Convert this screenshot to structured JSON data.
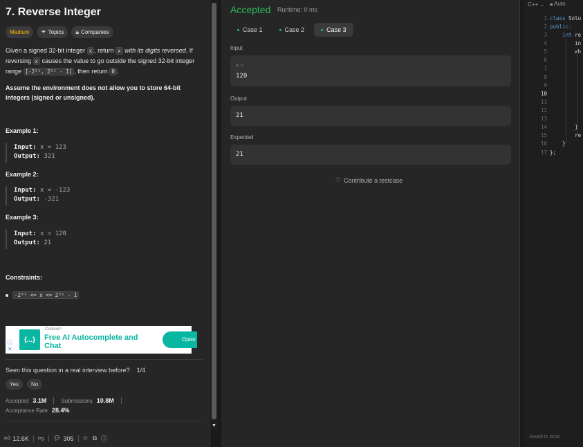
{
  "problem": {
    "title": "7. Reverse Integer",
    "tags": {
      "difficulty": "Medium",
      "topics": "Topics",
      "companies": "Companies"
    },
    "desc": {
      "p1": "Given a signed 32-bit integer",
      "x": "x",
      "p2": ", return",
      "p3": "with its digits reversed",
      "p4": ". If reversing",
      "p5": "causes the value to go outside the signed 32-bit integer range",
      "range_chip": "[-2³¹, 2³¹ - 1]",
      "p6": ", then return",
      "zero": "0",
      "p7": "."
    },
    "note": "Assume the environment does not allow you to store 64-bit integers (signed or unsigned).",
    "examples": [
      {
        "title": "Example 1:",
        "input_label": "Input:",
        "input": "x = 123",
        "output_label": "Output:",
        "output": "321"
      },
      {
        "title": "Example 2:",
        "input_label": "Input:",
        "input": "x = -123",
        "output_label": "Output:",
        "output": "-321"
      },
      {
        "title": "Example 3:",
        "input_label": "Input:",
        "input": "x = 120",
        "output_label": "Output:",
        "output": "21"
      }
    ],
    "constraints_title": "Constraints:",
    "constraint": "-2³¹ <= x <= 2³¹ - 1"
  },
  "ad": {
    "brand": "Codeium",
    "logo": "{...}",
    "headline": "Free AI Autocomplete and Chat",
    "cta": "Open"
  },
  "interview": {
    "question": "Seen this question in a real interview before?",
    "count": "1/4",
    "yes": "Yes",
    "no": "No"
  },
  "stats": {
    "accepted_label": "Accepted",
    "accepted": "3.1M",
    "submissions_label": "Submissions",
    "submissions": "10.8M",
    "rate_label": "Acceptance Rate",
    "rate": "28.4%"
  },
  "bottom_bar": {
    "likes": "12.6K",
    "comments": "305"
  },
  "result": {
    "status": "Accepted",
    "runtime": "Runtime: 0 ms",
    "cases": [
      "Case 1",
      "Case 2",
      "Case 3"
    ],
    "active_case": "Case 3",
    "input_label": "Input",
    "var_name": "x =",
    "input_value": "120",
    "output_label": "Output",
    "output_value": "21",
    "expected_label": "Expected",
    "expected_value": "21",
    "contribute": "Contribute a testcase"
  },
  "code": {
    "language": "C++",
    "mode": "Auto",
    "line_numbers": [
      "1",
      "2",
      "3",
      "4",
      "5",
      "6",
      "7",
      "8",
      "9",
      "10",
      "11",
      "12",
      "13",
      "14",
      "15",
      "16",
      "17"
    ],
    "current_line": "10",
    "lines": [
      "class Solu",
      "public:",
      "    int re",
      "        in",
      "        wh",
      "",
      "",
      "",
      "",
      "",
      "",
      "",
      "",
      "        }",
      "        re",
      "    }",
      "};"
    ],
    "saved": "Saved to local"
  },
  "colors": {
    "accepted": "#2cbb5d",
    "medium": "#ffb800",
    "ad_accent": "#09b6a2"
  }
}
